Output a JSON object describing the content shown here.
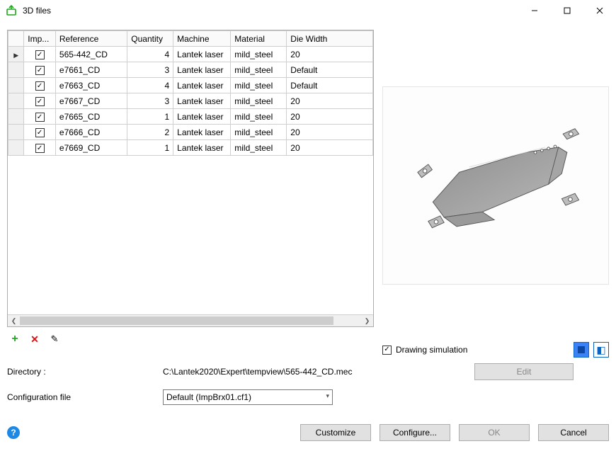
{
  "window": {
    "title": "3D files"
  },
  "grid": {
    "headers": {
      "selector": "",
      "import": "Imp...",
      "reference": "Reference",
      "quantity": "Quantity",
      "machine": "Machine",
      "material": "Material",
      "die_width": "Die Width"
    },
    "rows": [
      {
        "selected": true,
        "import_checked": true,
        "reference": "565-442_CD",
        "quantity": "4",
        "machine": "Lantek laser",
        "material": "mild_steel",
        "die_width": "20"
      },
      {
        "selected": false,
        "import_checked": true,
        "reference": "e7661_CD",
        "quantity": "3",
        "machine": "Lantek laser",
        "material": "mild_steel",
        "die_width": "Default"
      },
      {
        "selected": false,
        "import_checked": true,
        "reference": "e7663_CD",
        "quantity": "4",
        "machine": "Lantek laser",
        "material": "mild_steel",
        "die_width": "Default"
      },
      {
        "selected": false,
        "import_checked": true,
        "reference": "e7667_CD",
        "quantity": "3",
        "machine": "Lantek laser",
        "material": "mild_steel",
        "die_width": "20"
      },
      {
        "selected": false,
        "import_checked": true,
        "reference": "e7665_CD",
        "quantity": "1",
        "machine": "Lantek laser",
        "material": "mild_steel",
        "die_width": "20"
      },
      {
        "selected": false,
        "import_checked": true,
        "reference": "e7666_CD",
        "quantity": "2",
        "machine": "Lantek laser",
        "material": "mild_steel",
        "die_width": "20"
      },
      {
        "selected": false,
        "import_checked": true,
        "reference": "e7669_CD",
        "quantity": "1",
        "machine": "Lantek laser",
        "material": "mild_steel",
        "die_width": "20"
      }
    ]
  },
  "preview": {
    "drawing_simulation_label": "Drawing simulation",
    "drawing_simulation_checked": true
  },
  "form": {
    "directory_label": "Directory :",
    "directory_value": "C:\\Lantek2020\\Expert\\tempview\\565-442_CD.mec",
    "config_label": "Configuration file",
    "config_value": "Default (ImpBrx01.cf1)",
    "edit_button": "Edit"
  },
  "buttons": {
    "customize": "Customize",
    "configure": "Configure...",
    "ok": "OK",
    "cancel": "Cancel"
  }
}
